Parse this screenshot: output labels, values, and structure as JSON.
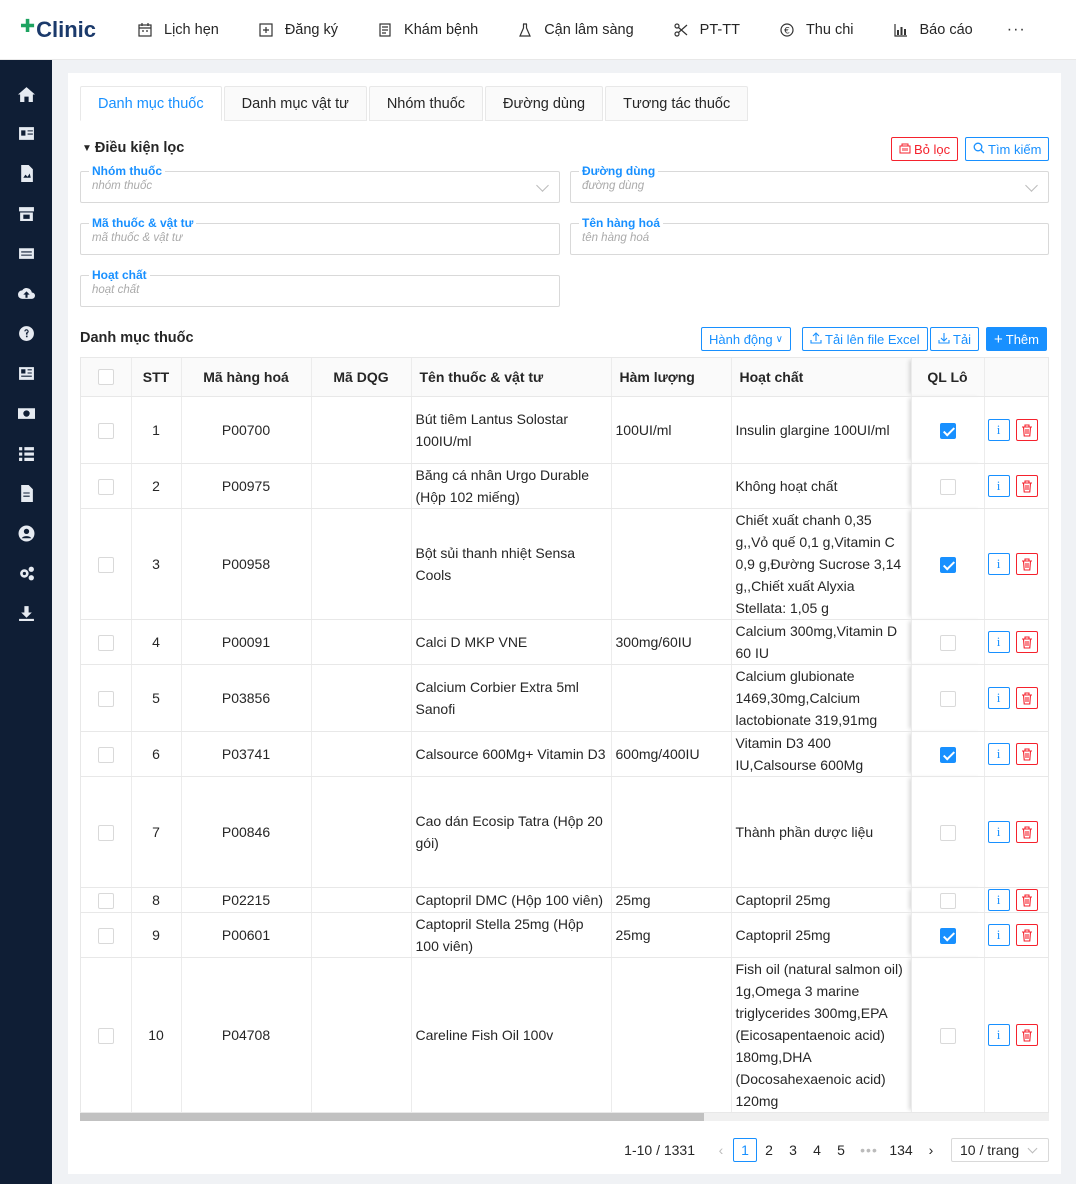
{
  "app": {
    "logo_text": "Clinic"
  },
  "nav": [
    {
      "label": "Lịch hẹn",
      "icon": "calendar-icon"
    },
    {
      "label": "Đăng ký",
      "icon": "plus-square-icon"
    },
    {
      "label": "Khám bệnh",
      "icon": "clipboard-icon"
    },
    {
      "label": "Cận lâm sàng",
      "icon": "flask-icon"
    },
    {
      "label": "PT-TT",
      "icon": "scissors-icon"
    },
    {
      "label": "Thu chi",
      "icon": "currency-icon"
    },
    {
      "label": "Báo cáo",
      "icon": "bar-chart-icon"
    }
  ],
  "nav_more": "···",
  "tabs": [
    "Danh mục thuốc",
    "Danh mục vật tư",
    "Nhóm thuốc",
    "Đường dùng",
    "Tương tác thuốc"
  ],
  "filter": {
    "title": "Điều kiện lọc",
    "clear_label": "Bỏ lọc",
    "search_label": "Tìm kiếm",
    "fields": {
      "group": {
        "label": "Nhóm thuốc",
        "placeholder": "nhóm thuốc"
      },
      "route": {
        "label": "Đường dùng",
        "placeholder": "đường dùng"
      },
      "code": {
        "label": "Mã thuốc & vật tư",
        "placeholder": "mã thuốc & vật tư"
      },
      "name": {
        "label": "Tên hàng hoá",
        "placeholder": "tên hàng hoá"
      },
      "ingredient": {
        "label": "Hoạt chất",
        "placeholder": "hoạt chất"
      }
    }
  },
  "list": {
    "title": "Danh mục thuốc",
    "actions_label": "Hành động",
    "upload_label": "Tải lên file Excel",
    "download_label": "Tải",
    "add_label": "Thêm"
  },
  "table": {
    "columns": [
      "STT",
      "Mã hàng hoá",
      "Mã DQG",
      "Tên thuốc & vật tư",
      "Hàm lượng",
      "Hoạt chất",
      "QL Lô"
    ],
    "rows": [
      {
        "stt": "1",
        "code": "P00700",
        "dqg": "",
        "name": "Bút tiêm Lantus Solostar 100IU/ml",
        "strength": "100UI/ml",
        "ingredient": "Insulin glargine 100UI/ml",
        "lot": true
      },
      {
        "stt": "2",
        "code": "P00975",
        "dqg": "",
        "name": "Băng cá nhân Urgo Durable (Hộp 102 miếng)",
        "strength": "",
        "ingredient": "Không hoạt chất",
        "lot": false
      },
      {
        "stt": "3",
        "code": "P00958",
        "dqg": "",
        "name": "Bột sủi thanh nhiệt Sensa Cools",
        "strength": "",
        "ingredient": "Chiết xuất chanh 0,35 g,,Vỏ quế 0,1 g,Vitamin C 0,9 g,Đường Sucrose 3,14 g,,Chiết xuất Alyxia Stellata: 1,05 g",
        "lot": true
      },
      {
        "stt": "4",
        "code": "P00091",
        "dqg": "",
        "name": "Calci D MKP VNE",
        "strength": "300mg/60IU",
        "ingredient": "Calcium 300mg,Vitamin D 60 IU",
        "lot": false
      },
      {
        "stt": "5",
        "code": "P03856",
        "dqg": "",
        "name": "Calcium Corbier Extra 5ml Sanofi",
        "strength": "",
        "ingredient": "Calcium glubionate 1469,30mg,Calcium lactobionate 319,91mg",
        "lot": false
      },
      {
        "stt": "6",
        "code": "P03741",
        "dqg": "",
        "name": "Calsource 600Mg+ Vitamin D3",
        "strength": "600mg/400IU",
        "ingredient": "Vitamin D3 400 IU,Calsourse 600Mg",
        "lot": true
      },
      {
        "stt": "7",
        "code": "P00846",
        "dqg": "",
        "name": "Cao dán Ecosip Tatra (Hộp 20 gói)",
        "strength": "",
        "ingredient": "Thành phần dược liệu",
        "lot": false
      },
      {
        "stt": "8",
        "code": "P02215",
        "dqg": "",
        "name": "Captopril DMC (Hộp 100 viên)",
        "strength": "25mg",
        "ingredient": "Captopril 25mg",
        "lot": false
      },
      {
        "stt": "9",
        "code": "P00601",
        "dqg": "",
        "name": "Captopril Stella 25mg (Hộp 100 viên)",
        "strength": "25mg",
        "ingredient": "Captopril 25mg",
        "lot": true
      },
      {
        "stt": "10",
        "code": "P04708",
        "dqg": "",
        "name": "Careline Fish Oil 100v",
        "strength": "",
        "ingredient": "Fish oil (natural salmon oil) 1g,Omega 3 marine triglycerides 300mg,EPA (Eicosapentaenoic acid) 180mg,DHA (Docosahexaenoic acid) 120mg",
        "lot": false
      }
    ],
    "info_glyph": "i"
  },
  "pagination": {
    "total": "1-10 / 1331",
    "pages": [
      "1",
      "2",
      "3",
      "4",
      "5"
    ],
    "ellipsis": "•••",
    "last": "134",
    "page_size": "10 / trang",
    "current": "1"
  },
  "colors": {
    "primary": "#1890ff",
    "danger": "#f5222d",
    "sidebar": "#0f1e35"
  }
}
